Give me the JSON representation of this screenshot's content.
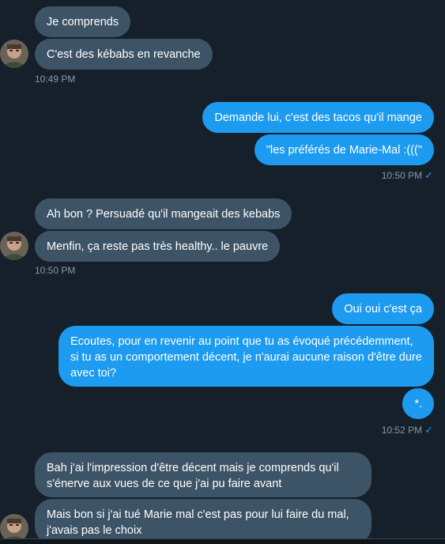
{
  "messages": {
    "m1": "Je comprends",
    "m2": "C'est des kébabs en revanche",
    "t1": "10:49 PM",
    "m3": "Demande lui, c'est des tacos qu'il mange",
    "m4": "\"les préférés de Marie-Mal :(((\"",
    "t2": "10:50 PM",
    "m5": "Ah bon ? Persuadé qu'il mangeait des kebabs",
    "m6": "Menfin, ça reste pas très healthy.. le pauvre",
    "t3": "10:50 PM",
    "m7": "Oui oui c'est ça",
    "m8": "Ecoutes, pour en revenir au point que tu as évoqué précédemment, si tu as un comportement décent, je n'aurai aucune raison d'être dure avec toi?",
    "m9": "*.",
    "t4": "10:52 PM",
    "m10": "Bah j'ai l'impression d'être décent mais je comprends qu'il s'énerve aux vues de ce que j'ai pu faire avant",
    "m11": "Mais bon si j'ai tué Marie mal c'est pas pour lui faire du mal, j'avais pas le choix"
  },
  "icons": {
    "read_receipt": "check-icon",
    "avatar": "user-avatar"
  },
  "colors": {
    "background": "#15202b",
    "incoming_bubble": "#3d5466",
    "outgoing_bubble": "#1d9bf0",
    "timestamp": "#8899a6"
  }
}
